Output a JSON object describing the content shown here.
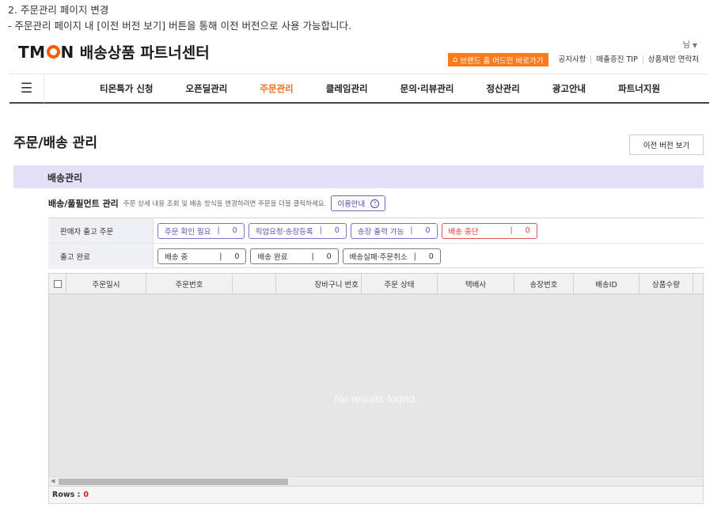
{
  "intro": {
    "line1": "2. 주문관리 페이지 변경",
    "line2": "- 주문관리 페이지 내 [이전 버전 보기] 버튼을 통해 이전 버전으로 사용 가능합니다."
  },
  "header": {
    "logo_text_left": "TM",
    "logo_text_right": "N",
    "logo_subtitle": "배송상품 파트너센터",
    "user_label": "님",
    "brand_home_button": "브랜드 홈 어드민 바로가기",
    "top_links": [
      "공지사항",
      "매출증진 TIP",
      "상품제안 연락처"
    ]
  },
  "nav": {
    "items": [
      "티몬특가 신청",
      "오픈딜관리",
      "주문관리",
      "클레임관리",
      "문의·리뷰관리",
      "정산관리",
      "광고안내",
      "파트너지원"
    ],
    "active_index": 2
  },
  "page": {
    "title": "주문/배송 관리",
    "prev_version_button": "이전 버전 보기",
    "section_title": "배송관리"
  },
  "fulfillment": {
    "title": "배송/풀필먼트 관리",
    "description": "주문 상세 내용 조회 및 배송 방식을 변경하려면 주문을 더블 클릭하세요.",
    "guide_button": "이용안내",
    "rows": [
      {
        "label": "판매자 출고 주문",
        "chips": [
          {
            "label": "주문 확인 필요",
            "count": "0",
            "style": "purple"
          },
          {
            "label": "픽업요청·송장등록",
            "count": "0",
            "style": "purple"
          },
          {
            "label": "송장 출력 가능",
            "count": "0",
            "style": "purple"
          },
          {
            "label": "배송 중단",
            "count": "0",
            "style": "red"
          }
        ]
      },
      {
        "label": "출고 완료",
        "chips": [
          {
            "label": "배송 중",
            "count": "0",
            "style": "gray"
          },
          {
            "label": "배송 완료",
            "count": "0",
            "style": "gray"
          },
          {
            "label": "배송실패·주문취소",
            "count": "0",
            "style": "gray"
          }
        ]
      }
    ]
  },
  "grid": {
    "columns": [
      "주문일시",
      "주문번호",
      "",
      "장바구니 번호",
      "주문 상태",
      "택배사",
      "송장번호",
      "배송ID",
      "상품수량"
    ],
    "empty_message": "No results found.",
    "rows_label": "Rows :",
    "rows_value": "0"
  },
  "colors": {
    "accent": "#ff6a13",
    "brand_button": "#ff7a1a",
    "section_bar": "#e2e0f7",
    "chip_purple": "#7a72cf",
    "chip_red": "#e25555"
  }
}
